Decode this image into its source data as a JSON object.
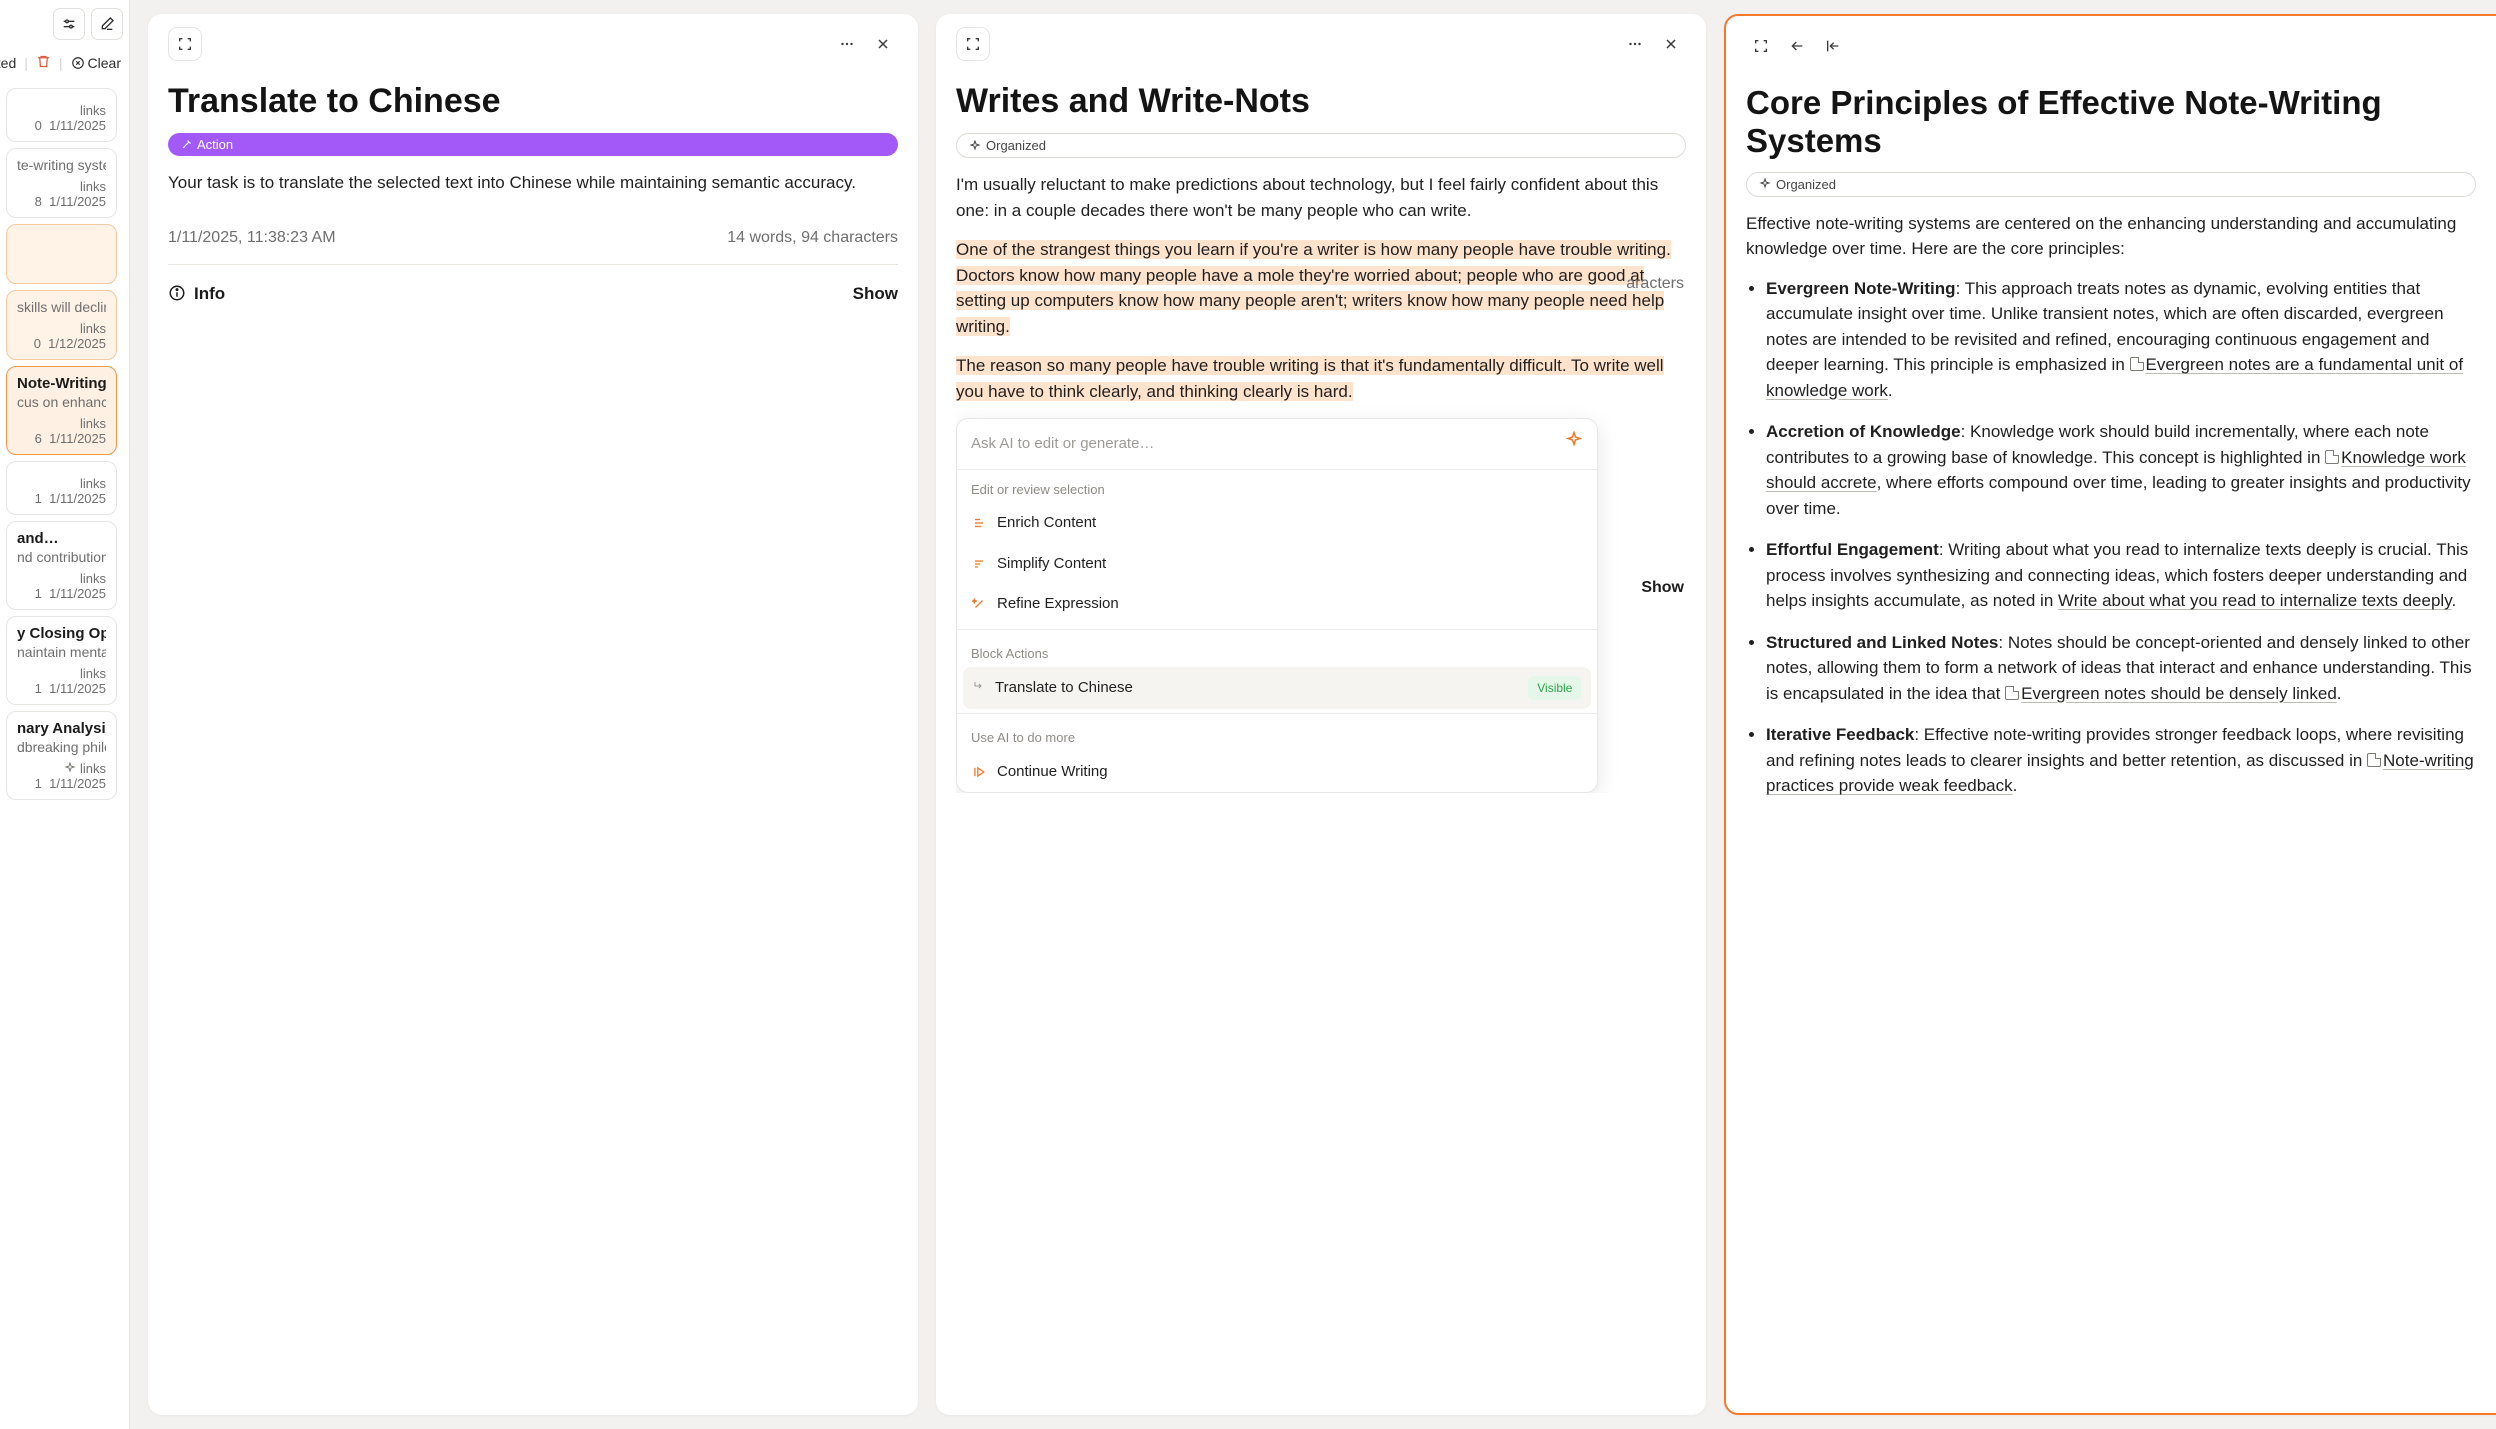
{
  "sidebar": {
    "filters": {
      "text": "ted",
      "clear": "Clear"
    },
    "items": [
      {
        "title": "",
        "snip": "",
        "links": "links 0",
        "date": "1/11/2025"
      },
      {
        "title": "",
        "snip": "te-writing systems,…",
        "links": "links 8",
        "date": "1/11/2025"
      },
      {
        "title": "",
        "snip": "skills will decline …",
        "links": "links 0",
        "date": "1/12/2025"
      },
      {
        "title": "Note-Writing…",
        "snip": "cus on enhancing u…",
        "links": "links 6",
        "date": "1/11/2025"
      },
      {
        "title": "",
        "snip": "",
        "links": "links 1",
        "date": "1/11/2025"
      },
      {
        "title": "and…",
        "snip": "nd contributions to…",
        "links": "links 1",
        "date": "1/11/2025"
      },
      {
        "title": "y Closing Open…",
        "snip": "naintain mental cla…",
        "links": "links 1",
        "date": "1/11/2025"
      },
      {
        "title": "nary Analysis",
        "snip": "dbreaking philoso…",
        "links": "links 1",
        "date": "1/11/2025"
      }
    ]
  },
  "pane1": {
    "title": "Translate to Chinese",
    "badge": "Action",
    "body": "Your task is to translate the selected text into Chinese while maintaining semantic accuracy.",
    "timestamp": "1/11/2025, 11:38:23 AM",
    "stats": "14 words, 94 characters",
    "info": "Info",
    "show": "Show"
  },
  "pane2": {
    "title": "Writes and Write-Nots",
    "badge": "Organized",
    "p1": "I'm usually reluctant to make predictions about technology, but I feel fairly confident about this one: in a couple decades there won't be many people who can write.",
    "p2": "One of the strangest things you learn if you're a writer is how many people have trouble writing. Doctors know how many people have a mole they're worried about; people who are good at setting up computers know how many people aren't; writers know how many people need help writing.",
    "p3": "The reason so many people have trouble writing is that it's fundamentally difficult. To write well you have to think clearly, and thinking clearly is hard.",
    "behind_stats": "aracters",
    "behind_show": "Show",
    "ai": {
      "placeholder": "Ask AI to edit or generate…",
      "sec1": "Edit or review selection",
      "enrich": "Enrich Content",
      "simplify": "Simplify Content",
      "refine": "Refine Expression",
      "sec2": "Block Actions",
      "translate": "Translate to Chinese",
      "visible": "Visible",
      "sec3": "Use AI to do more",
      "continue": "Continue Writing"
    }
  },
  "pane3": {
    "title": "Core Principles of Effective Note-Writing Systems",
    "badge": "Organized",
    "intro": "Effective note-writing systems are centered on the enhancing understanding and accumulating knowledge over time. Here are the core principles:",
    "b1_t": "Evergreen Note-Writing",
    "b1": ": This approach treats notes as dynamic, evolving entities that accumulate insight over time. Unlike transient notes, which are often discarded, evergreen notes are intended to be revisited and refined, encouraging continuous engagement and deeper learning. This principle is emphasized in ",
    "b1_link": "Evergreen notes are a fundamental unit of knowledge work",
    "b2_t": "Accretion of Knowledge",
    "b2": ": Knowledge work should build incrementally, where each note contributes to a growing base of knowledge. This concept is highlighted in ",
    "b2_link": "Knowledge work should accrete",
    "b2_after": ", where efforts compound over time, leading to greater insights and productivity over time.",
    "b3_t": "Effortful Engagement",
    "b3": ": Writing about what you read to internalize texts deeply is crucial. This process involves synthesizing and connecting ideas, which fosters deeper understanding and helps insights accumulate, as noted in ",
    "b3_link": "Write about what you read to internalize texts deeply",
    "b4_t": "Structured and Linked Notes",
    "b4": ": Notes should be concept-oriented and densely linked to other notes, allowing them to form a network of ideas that interact and enhance understanding. This is encapsulated in the idea that ",
    "b4_link": "Evergreen notes should be densely linked",
    "b5_t": "Iterative Feedback",
    "b5": ": Effective note-writing provides stronger feedback loops, where revisiting and refining notes leads to clearer insights and better retention, as discussed in ",
    "b5_link": "Note-writing practices provide weak feedback"
  }
}
